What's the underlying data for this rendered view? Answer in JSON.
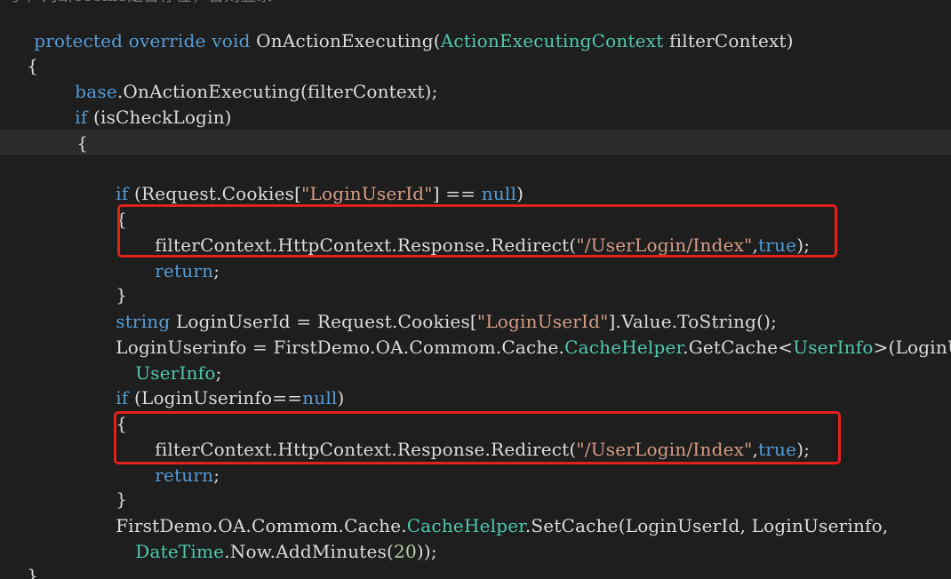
{
  "editor": {
    "cut_line": "了，判断cookie是否存在，否则登录",
    "code": {
      "l1": {
        "a": "protected",
        "b": " ",
        "c": "override",
        "d": " ",
        "e": "void",
        "f": " OnActionExecuting(",
        "g": "ActionExecutingContext",
        "h": " filterContext)"
      },
      "l2": {
        "a": "{"
      },
      "l3": {
        "a": "base",
        "b": ".OnActionExecuting(filterContext);"
      },
      "l4": {
        "a": "if",
        "b": " (isCheckLogin)"
      },
      "l5": {
        "a": "{"
      },
      "l6": {
        "a": "if",
        "b": " (Request.Cookies[",
        "c": "\"LoginUserId\"",
        "d": "] == ",
        "e": "null",
        "f": ")"
      },
      "l7": {
        "a": "{"
      },
      "l8": {
        "a": "filterContext.HttpContext.Response.Redirect(",
        "b": "\"/UserLogin/Index\"",
        "c": ",",
        "d": "true",
        "e": ");"
      },
      "l9": {
        "a": "return",
        "b": ";"
      },
      "l10": {
        "a": "}"
      },
      "l11": {
        "a": "string",
        "b": " LoginUserId = Request.Cookies[",
        "c": "\"LoginUserId\"",
        "d": "].Value.ToString();"
      },
      "l12": {
        "a": "LoginUserinfo = FirstDemo.OA.Commom.Cache.",
        "b": "CacheHelper",
        "c": ".GetCache<",
        "d": "UserInfo",
        "e": ">(LoginUserId)"
      },
      "l13": {
        "a": "UserInfo",
        "b": ";"
      },
      "l14": {
        "a": "if",
        "b": " (LoginUserinfo==",
        "c": "null",
        "d": ")"
      },
      "l15": {
        "a": "{"
      },
      "l16": {
        "a": "filterContext.HttpContext.Response.Redirect(",
        "b": "\"/UserLogin/Index\"",
        "c": ",",
        "d": "true",
        "e": ");"
      },
      "l17": {
        "a": "return",
        "b": ";"
      },
      "l18": {
        "a": "}"
      },
      "l19": {
        "a": "FirstDemo.OA.Commom.Cache.",
        "b": "CacheHelper",
        "c": ".SetCache(LoginUserId, LoginUserinfo,"
      },
      "l20": {
        "a": "DateTime",
        "b": ".Now.AddMinutes(",
        "c": "20",
        "d": "));"
      },
      "l21": {
        "a": "}"
      }
    }
  }
}
